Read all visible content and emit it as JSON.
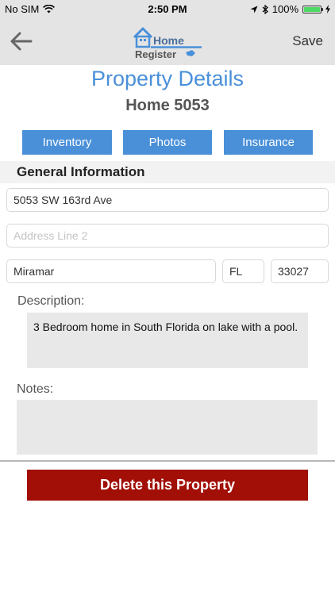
{
  "status_bar": {
    "carrier": "No SIM",
    "time": "2:50 PM",
    "battery": "100%"
  },
  "nav": {
    "logo_line1": "Home",
    "logo_line2": "Register",
    "save_label": "Save"
  },
  "page": {
    "title": "Property Details",
    "property_name": "Home 5053"
  },
  "tabs": [
    {
      "label": "Inventory"
    },
    {
      "label": "Photos"
    },
    {
      "label": "Insurance"
    }
  ],
  "general": {
    "heading": "General Information",
    "address1": "5053 SW 163rd Ave",
    "address2_placeholder": "Address Line 2",
    "city": "Miramar",
    "state": "FL",
    "zip": "33027"
  },
  "description": {
    "label": "Description:",
    "value": "3 Bedroom home in South Florida on lake with a pool."
  },
  "notes": {
    "label": "Notes:",
    "value": ""
  },
  "delete_label": "Delete this Property",
  "colors": {
    "accent": "#4a90d9",
    "danger": "#a10f06",
    "bar_bg": "#e4e4e4"
  }
}
